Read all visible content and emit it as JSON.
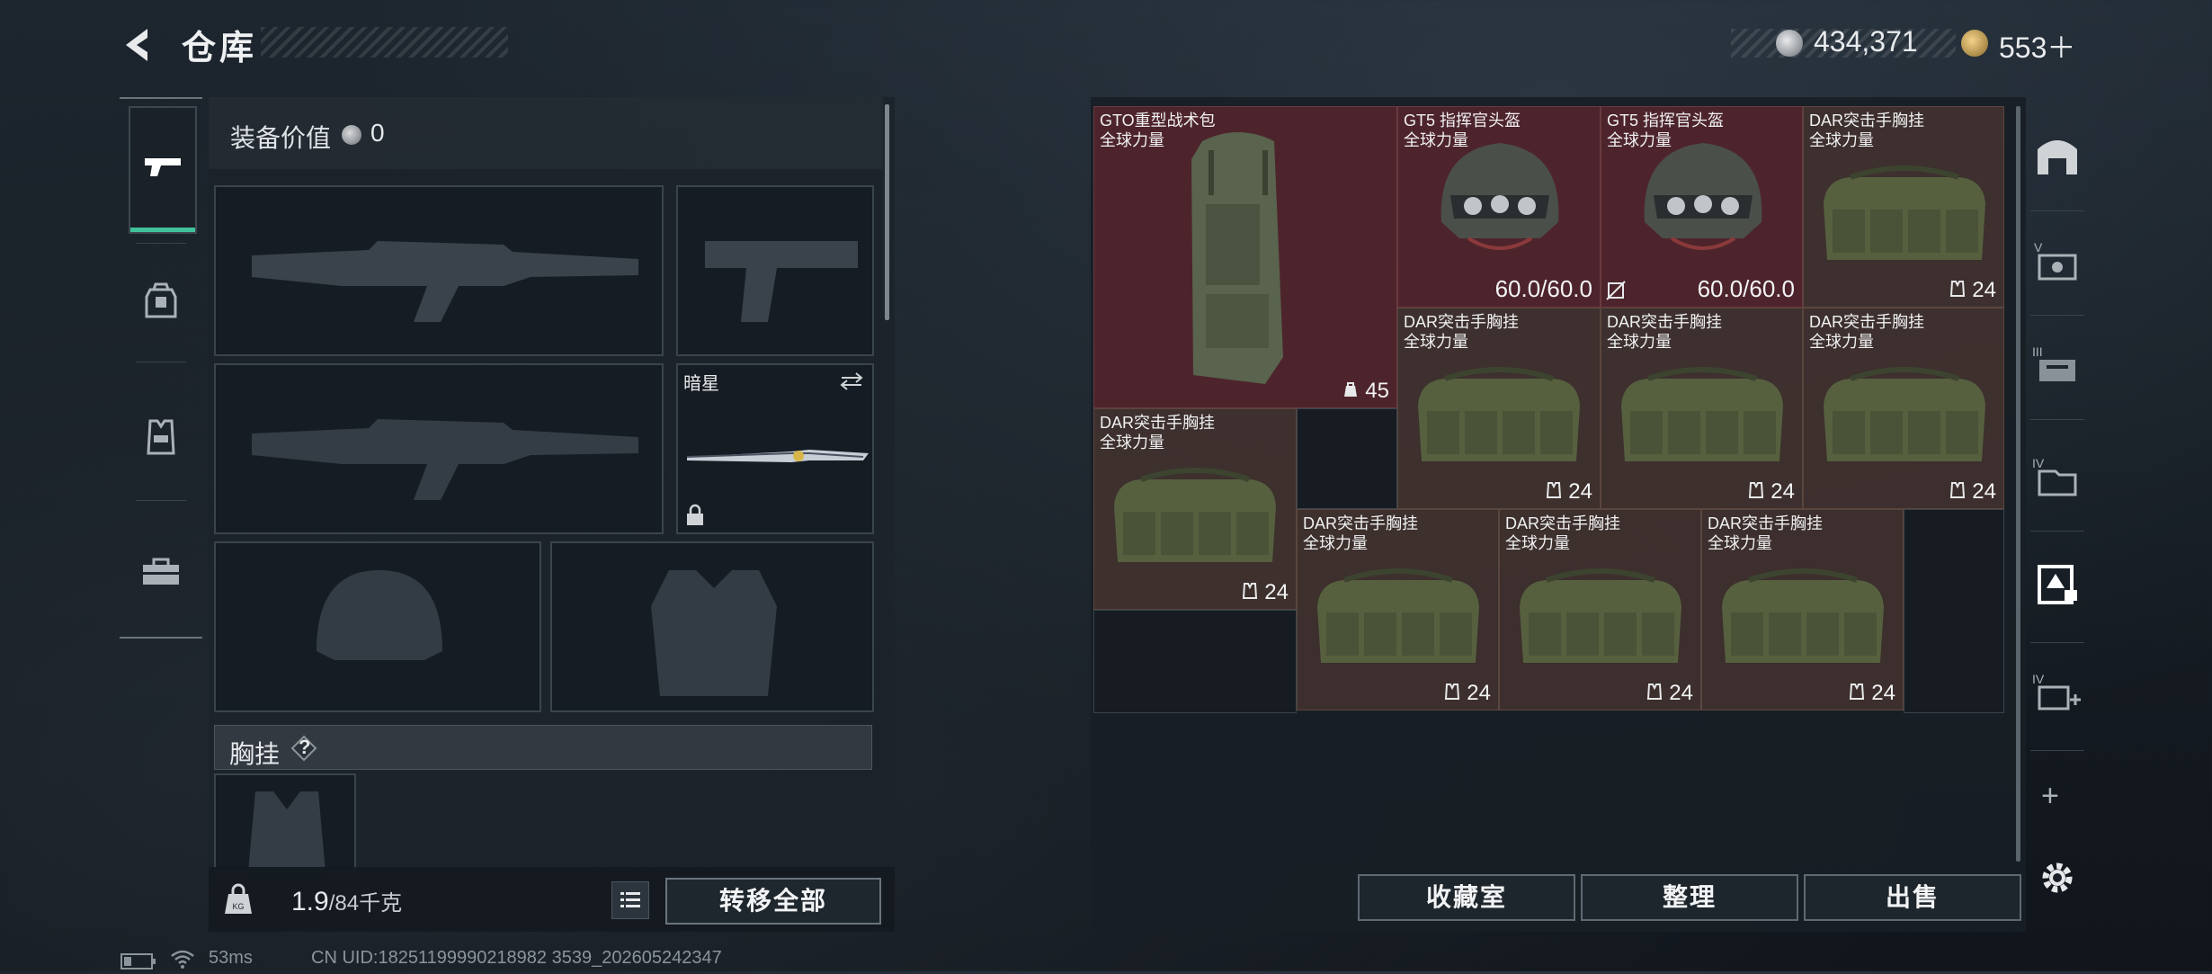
{
  "header": {
    "title": "仓库",
    "currency_silver": "434,371",
    "currency_gold": "553＋"
  },
  "equipment": {
    "value_label": "装备价值",
    "value": "0",
    "knife_name": "暗星",
    "chest_label": "胸挂",
    "chest_help": "?",
    "weight_value": "1.9",
    "weight_capacity": "/84千克",
    "transfer_all": "转移全部"
  },
  "storage": {
    "items": [
      {
        "name": "GTO重型战术包",
        "sub": "全球力量",
        "count": "45",
        "kind": "backpack"
      },
      {
        "name": "GT5 指挥官头盔",
        "sub": "全球力量",
        "durability": "60.0/60.0",
        "kind": "helmet"
      },
      {
        "name": "GT5 指挥官头盔",
        "sub": "全球力量",
        "durability": "60.0/60.0",
        "kind": "helmet"
      },
      {
        "name": "DAR突击手胸挂",
        "sub": "全球力量",
        "count": "24",
        "kind": "rig"
      },
      {
        "name": "DAR突击手胸挂",
        "sub": "全球力量",
        "count": "24",
        "kind": "rig"
      },
      {
        "name": "DAR突击手胸挂",
        "sub": "全球力量",
        "count": "24",
        "kind": "rig"
      },
      {
        "name": "DAR突击手胸挂",
        "sub": "全球力量",
        "count": "24",
        "kind": "rig"
      },
      {
        "name": "DAR突击手胸挂",
        "sub": "全球力量",
        "count": "24",
        "kind": "rig"
      },
      {
        "name": "DAR突击手胸挂",
        "sub": "全球力量",
        "count": "24",
        "kind": "rig"
      },
      {
        "name": "DAR突击手胸挂",
        "sub": "全球力量",
        "count": "24",
        "kind": "rig"
      },
      {
        "name": "DAR突击手胸挂",
        "sub": "全球力量",
        "count": "24",
        "kind": "rig"
      }
    ]
  },
  "buttons": {
    "collection": "收藏室",
    "sort": "整理",
    "sell": "出售"
  },
  "right_nav": {
    "add": "+"
  },
  "status": {
    "ping": "53ms",
    "uid": "CN UID:18251199990218982 3539_202605242347"
  }
}
